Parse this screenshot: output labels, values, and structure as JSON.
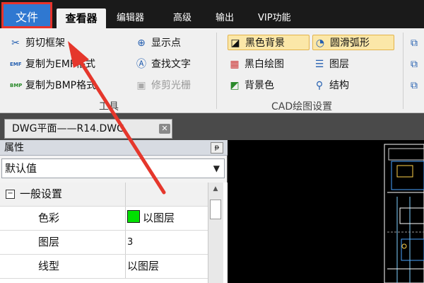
{
  "tabs": {
    "file": "文件",
    "viewer": "查看器",
    "editor": "编辑器",
    "advanced": "高级",
    "output": "输出",
    "vip": "VIP功能"
  },
  "ribbon": {
    "tools_group_label": "工具",
    "cad_group_label": "CAD绘图设置",
    "clip_frame": "剪切框架",
    "copy_emf": "复制为EMF格式",
    "copy_bmp": "复制为BMP格式",
    "show_points": "显示点",
    "find_text": "查找文字",
    "trim_raster": "修剪光栅",
    "black_background": "黑色背景",
    "bw_drawing": "黑白绘图",
    "background_color": "背景色",
    "smooth_arc": "圆滑弧形",
    "layers": "图层",
    "structure": "结构",
    "emf_badge": "EMF",
    "bmp_badge": "BMP"
  },
  "document": {
    "tab_title": "DWG平面——R14.DWG",
    "close_glyph": "✕"
  },
  "properties": {
    "title": "属性",
    "pin_glyph": "ᵽ",
    "selected_value": "默认值",
    "general_section": "一般设置",
    "collapse_glyph": "−",
    "rows": [
      {
        "name": "色彩",
        "value": "以图层"
      },
      {
        "name": "图层",
        "value": "3"
      },
      {
        "name": "线型",
        "value": "以图层"
      }
    ]
  },
  "colors": {
    "accent": "#2f78d1",
    "highlight_border": "#e8332a",
    "layer_color": "#00e000",
    "active_button": "#fbe7a8"
  },
  "icons": [
    "clip-frame-icon",
    "emf-icon",
    "bmp-icon",
    "crosshair-icon",
    "find-text-icon",
    "trim-raster-icon",
    "black-bg-icon",
    "bw-drawing-icon",
    "bg-color-icon",
    "smooth-arc-icon",
    "layers-icon",
    "structure-icon",
    "close-icon",
    "pin-icon",
    "chevron-down-icon",
    "red-arrow-annotation"
  ]
}
